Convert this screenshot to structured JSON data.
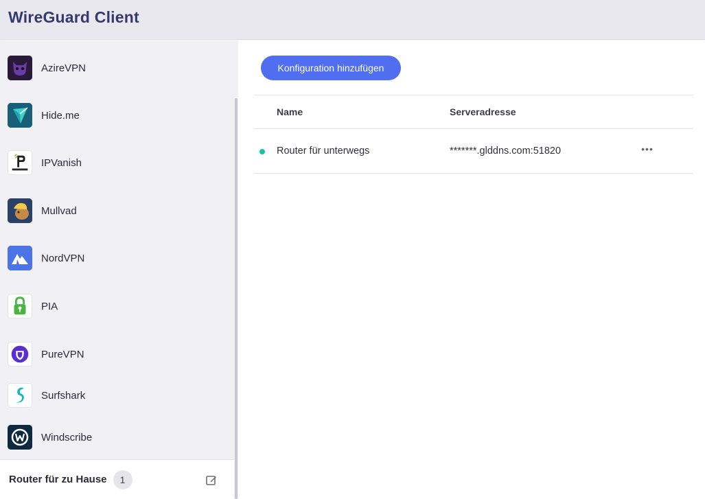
{
  "app": {
    "title": "WireGuard Client"
  },
  "sidebar": {
    "providers": [
      {
        "label": "AzireVPN",
        "icon": "azirevpn-logo-icon",
        "color": "#2a1a3a"
      },
      {
        "label": "Hide.me",
        "icon": "hideme-logo-icon",
        "color": "#1a5f78"
      },
      {
        "label": "IPVanish",
        "icon": "ipvanish-logo-icon",
        "color": "#ffffff"
      },
      {
        "label": "Mullvad",
        "icon": "mullvad-logo-icon",
        "color": "#294068"
      },
      {
        "label": "NordVPN",
        "icon": "nordvpn-logo-icon",
        "color": "#4a74e8"
      },
      {
        "label": "PIA",
        "icon": "pia-logo-icon",
        "color": "#ffffff"
      },
      {
        "label": "PureVPN",
        "icon": "purevpn-logo-icon",
        "color": "#ffffff"
      },
      {
        "label": "Surfshark",
        "icon": "surfshark-logo-icon",
        "color": "#ffffff"
      },
      {
        "label": "Windscribe",
        "icon": "windscribe-logo-icon",
        "color": "#0f2a40"
      }
    ],
    "current": {
      "name": "Router für zu Hause",
      "count": "1",
      "edit_icon": "edit-icon"
    }
  },
  "main": {
    "add_button_label": "Konfiguration hinzufügen",
    "table": {
      "columns": [
        "Name",
        "Serveradresse"
      ],
      "rows": [
        {
          "name": "Router für unterwegs",
          "server": "*******.glddns.com:51820",
          "status_color": "#18c4a4",
          "more": "•••"
        }
      ]
    }
  },
  "colors": {
    "accent": "#4f6ff0",
    "header_bg": "#e9e8ee",
    "sidebar_bg": "#f1f0f5",
    "title": "#343a6b"
  }
}
